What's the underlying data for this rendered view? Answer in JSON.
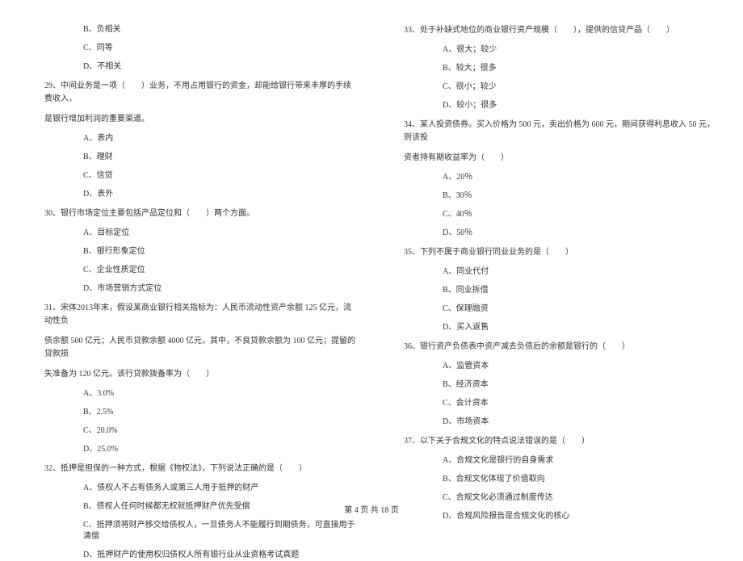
{
  "left_column": {
    "q28_options": {
      "b": "B、负相关",
      "c": "C、同等",
      "d": "D、不相关"
    },
    "q29": {
      "text": "29、中间业务是一项（　　）业务，不用占用银行的资金，却能给银行带来丰厚的手续费收入，",
      "text2": "是银行增加利润的重要渠道。",
      "a": "A、表内",
      "b": "B、理财",
      "c": "C、信贷",
      "d": "D、表外"
    },
    "q30": {
      "text": "30、银行市场定位主要包括产品定位和（　　）两个方面。",
      "a": "A、目标定位",
      "b": "B、银行形象定位",
      "c": "C、企业性质定位",
      "d": "D、市场营销方式定位"
    },
    "q31": {
      "text": "31、宋体2013年末，假设某商业银行相关指标为：人民币流动性资产余额 125 亿元，流动性负",
      "text2": "债余额 500 亿元；人民币贷款余额 4000 亿元，其中，不良贷款余额为 100 亿元；提留的贷款损",
      "text3": "失准备为 120 亿元。该行贷款拨备率为（　　）",
      "a": "A、3.0%",
      "b": "B、2.5%",
      "c": "C、20.0%",
      "d": "D、25.0%"
    },
    "q32": {
      "text": "32、抵押是担保的一种方式，根据《物权法》，下列说法正确的是（　　）",
      "a": "A、债权人不占有债务人或第三人用于抵押的财产",
      "b": "B、债权人任何时候都无权就抵押财产优先受偿",
      "c": "C、抵押须将财产移交给债权人，一旦债务人不能履行到期债务，可直接用于清偿",
      "d": "D、抵押财产的使用权归债权人所有银行业从业资格考试真题"
    }
  },
  "right_column": {
    "q33": {
      "text": "33、处于补缺式地位的商业银行资产规模（　　），提供的信贷产品（　　）",
      "a": "A、很大；较少",
      "b": "B、较大；很多",
      "c": "C、很小；较少",
      "d": "D、较小；很多"
    },
    "q34": {
      "text": "34、某人投资债券。买入价格为 500 元，卖出价格为 600 元，期间获得利息收入 50 元，则该投",
      "text2": "资者持有期收益率为（　　）",
      "a": "A、20％",
      "b": "B、30％",
      "c": "C、40％",
      "d": "D、50％"
    },
    "q35": {
      "text": "35、下列不属于商业银行同业业务的是（　　）",
      "a": "A、同业代付",
      "b": "B、同业拆借",
      "c": "C、保理融资",
      "d": "D、买入返售"
    },
    "q36": {
      "text": "36、银行资产负债表中资产减去负债后的余额是银行的（　　）",
      "a": "A、监管资本",
      "b": "B、经济资本",
      "c": "C、会计资本",
      "d": "D、市场资本"
    },
    "q37": {
      "text": "37、以下关于合规文化的特点说法错误的是（　　）",
      "a": "A、合规文化是银行的自身需求",
      "b": "B、合规文化体现了价值取向",
      "c": "C、合规文化必须通过制度传达",
      "d": "D、合规风险报告是合规文化的核心"
    }
  },
  "footer": "第 4 页 共 18 页"
}
